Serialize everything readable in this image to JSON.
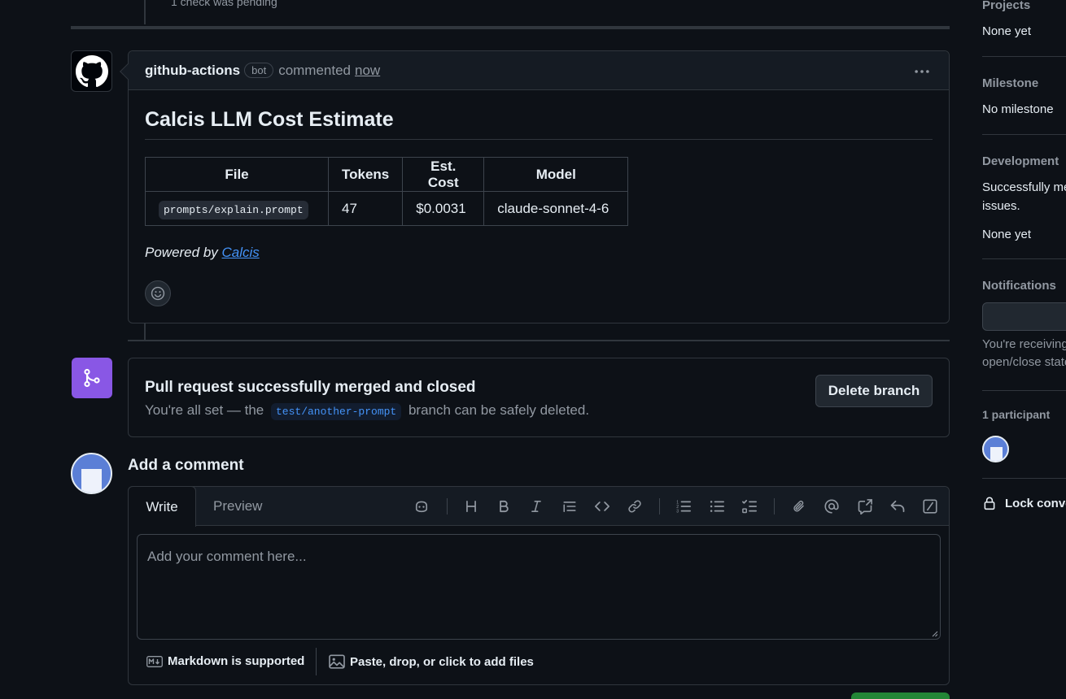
{
  "timeline": {
    "pending_text": "1 check was pending"
  },
  "comment": {
    "author": "github-actions",
    "badge": "bot",
    "action": "commented",
    "time": "now",
    "title": "Calcis LLM Cost Estimate",
    "table": {
      "headers": [
        "File",
        "Tokens",
        "Est. Cost",
        "Model"
      ],
      "rows": [
        {
          "file": "prompts/explain.prompt",
          "tokens": "47",
          "cost": "$0.0031",
          "model": "claude-sonnet-4-6"
        }
      ]
    },
    "powered_prefix": "Powered by",
    "powered_link": "Calcis"
  },
  "merged": {
    "title": "Pull request successfully merged and closed",
    "sub_before": "You're all set — the",
    "branch": "test/another-prompt",
    "sub_after": "branch can be safely deleted.",
    "delete_label": "Delete branch"
  },
  "add_comment": {
    "title": "Add a comment",
    "tab_write": "Write",
    "tab_preview": "Preview",
    "placeholder": "Add your comment here...",
    "markdown_note": "Markdown is supported",
    "files_note": "Paste, drop, or click to add files"
  },
  "sidebar": {
    "projects_heading": "Projects",
    "projects_value": "None yet",
    "milestone_heading": "Milestone",
    "milestone_value": "No milestone",
    "development_heading": "Development",
    "development_line1": "Successfully me",
    "development_line2": "issues.",
    "development_value": "None yet",
    "notifications_heading": "Notifications",
    "notifications_line1": "You're receiving",
    "notifications_line2": "open/close state",
    "participants": "1 participant",
    "lock_label": "Lock conve"
  },
  "colors": {
    "merged": "#8957e5",
    "accent": "#4493f8",
    "success": "#238636"
  }
}
